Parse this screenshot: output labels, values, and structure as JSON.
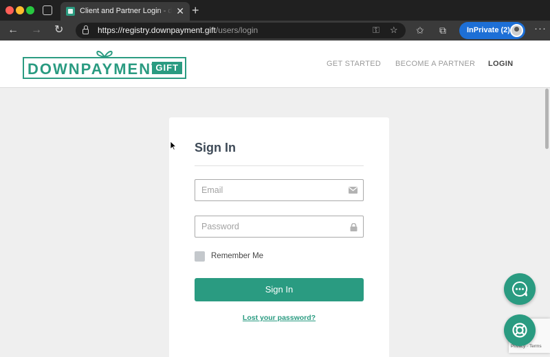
{
  "browser": {
    "tab_title": "Client and Partner Login - downpayment.gift",
    "url_host": "https://registry.downpayment.gift",
    "url_path": "/users/login",
    "inprivate_label": "InPrivate (2)",
    "icons": {
      "tab_actions": "tab-actions-icon",
      "close": "close-icon",
      "new_tab": "plus-icon",
      "back": "arrow-left-icon",
      "forward": "arrow-right-icon",
      "reload": "reload-icon",
      "lock": "lock-icon",
      "key": "key-icon",
      "add_favorite": "star-plus-icon",
      "favorites": "favorites-icon",
      "collections": "collections-icon",
      "more": "more-icon"
    }
  },
  "site": {
    "logo_text": "DOWNPAYMENT.",
    "logo_badge": "GIFT",
    "nav": [
      "GET STARTED",
      "BECOME A PARTNER",
      "LOGIN"
    ],
    "active_nav": "LOGIN"
  },
  "login": {
    "title": "Sign In",
    "email_placeholder": "Email",
    "password_placeholder": "Password",
    "remember_label": "Remember Me",
    "remember_checked": false,
    "submit_label": "Sign In",
    "lost_password_link": "Lost your password?"
  },
  "widgets": {
    "chat_icon": "chat-bubble-icon",
    "help_icon": "lifebuoy-icon",
    "recaptcha_text": "Privacy · Terms"
  },
  "colors": {
    "brand": "#2a9b81",
    "inprivate": "#1d6fd6",
    "page_bg": "#efefef"
  }
}
